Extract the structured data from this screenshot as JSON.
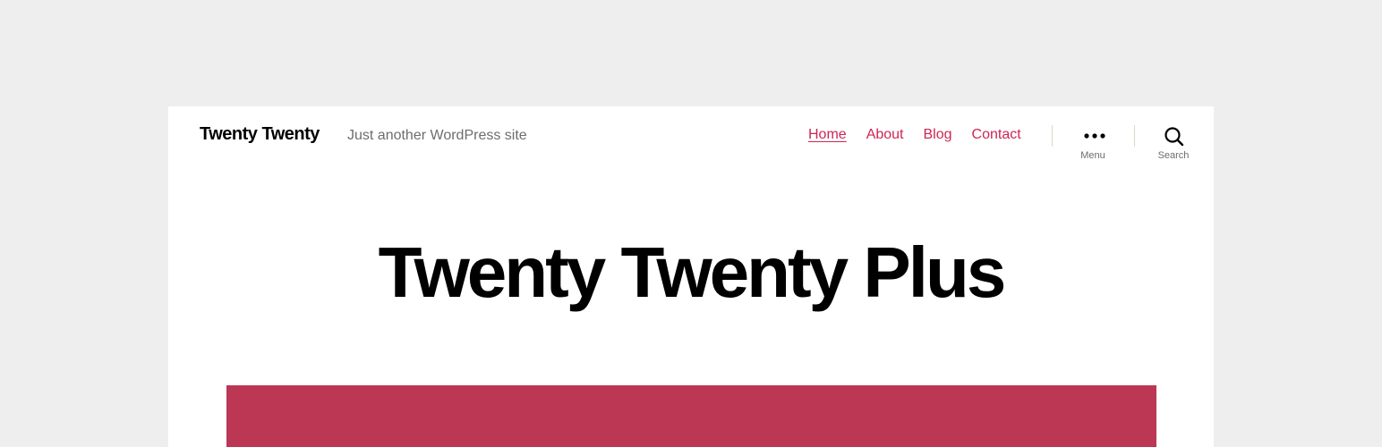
{
  "header": {
    "site_title": "Twenty Twenty",
    "site_description": "Just another WordPress site"
  },
  "nav": {
    "items": [
      {
        "label": "Home",
        "current": true
      },
      {
        "label": "About",
        "current": false
      },
      {
        "label": "Blog",
        "current": false
      },
      {
        "label": "Contact",
        "current": false
      }
    ]
  },
  "toggles": {
    "menu": {
      "label": "Menu",
      "icon": "more-dots-icon"
    },
    "search": {
      "label": "Search",
      "icon": "search-icon"
    }
  },
  "main": {
    "heading": "Twenty Twenty Plus"
  },
  "colors": {
    "page_background": "#eeeeee",
    "accent": "#cd2653",
    "cover_block": "#bb3754",
    "text": "#000000",
    "secondary_text": "#6d6d6d"
  }
}
